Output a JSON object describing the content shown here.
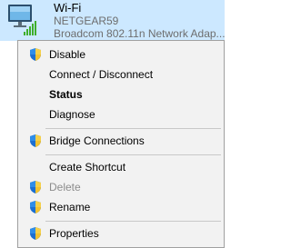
{
  "adapter": {
    "name": "Wi-Fi",
    "ssid": "NETGEAR59",
    "device": "Broadcom 802.11n Network Adap..."
  },
  "menu": {
    "items": [
      {
        "label": "Disable",
        "icon": "shield-icon",
        "bold": false,
        "disabled": false
      },
      {
        "label": "Connect / Disconnect",
        "icon": null,
        "bold": false,
        "disabled": false
      },
      {
        "label": "Status",
        "icon": null,
        "bold": true,
        "disabled": false
      },
      {
        "label": "Diagnose",
        "icon": null,
        "bold": false,
        "disabled": false
      },
      {
        "label": "Bridge Connections",
        "icon": "shield-icon",
        "bold": false,
        "disabled": false
      },
      {
        "label": "Create Shortcut",
        "icon": null,
        "bold": false,
        "disabled": false
      },
      {
        "label": "Delete",
        "icon": "shield-icon",
        "bold": false,
        "disabled": true
      },
      {
        "label": "Rename",
        "icon": "shield-icon",
        "bold": false,
        "disabled": false
      },
      {
        "label": "Properties",
        "icon": "shield-icon",
        "bold": false,
        "disabled": false
      }
    ]
  },
  "colors": {
    "selection": "#cce8ff",
    "menu_background": "#f2f2f2",
    "disabled_text": "#8c8c8c",
    "signal_green": "#3fae2a"
  }
}
